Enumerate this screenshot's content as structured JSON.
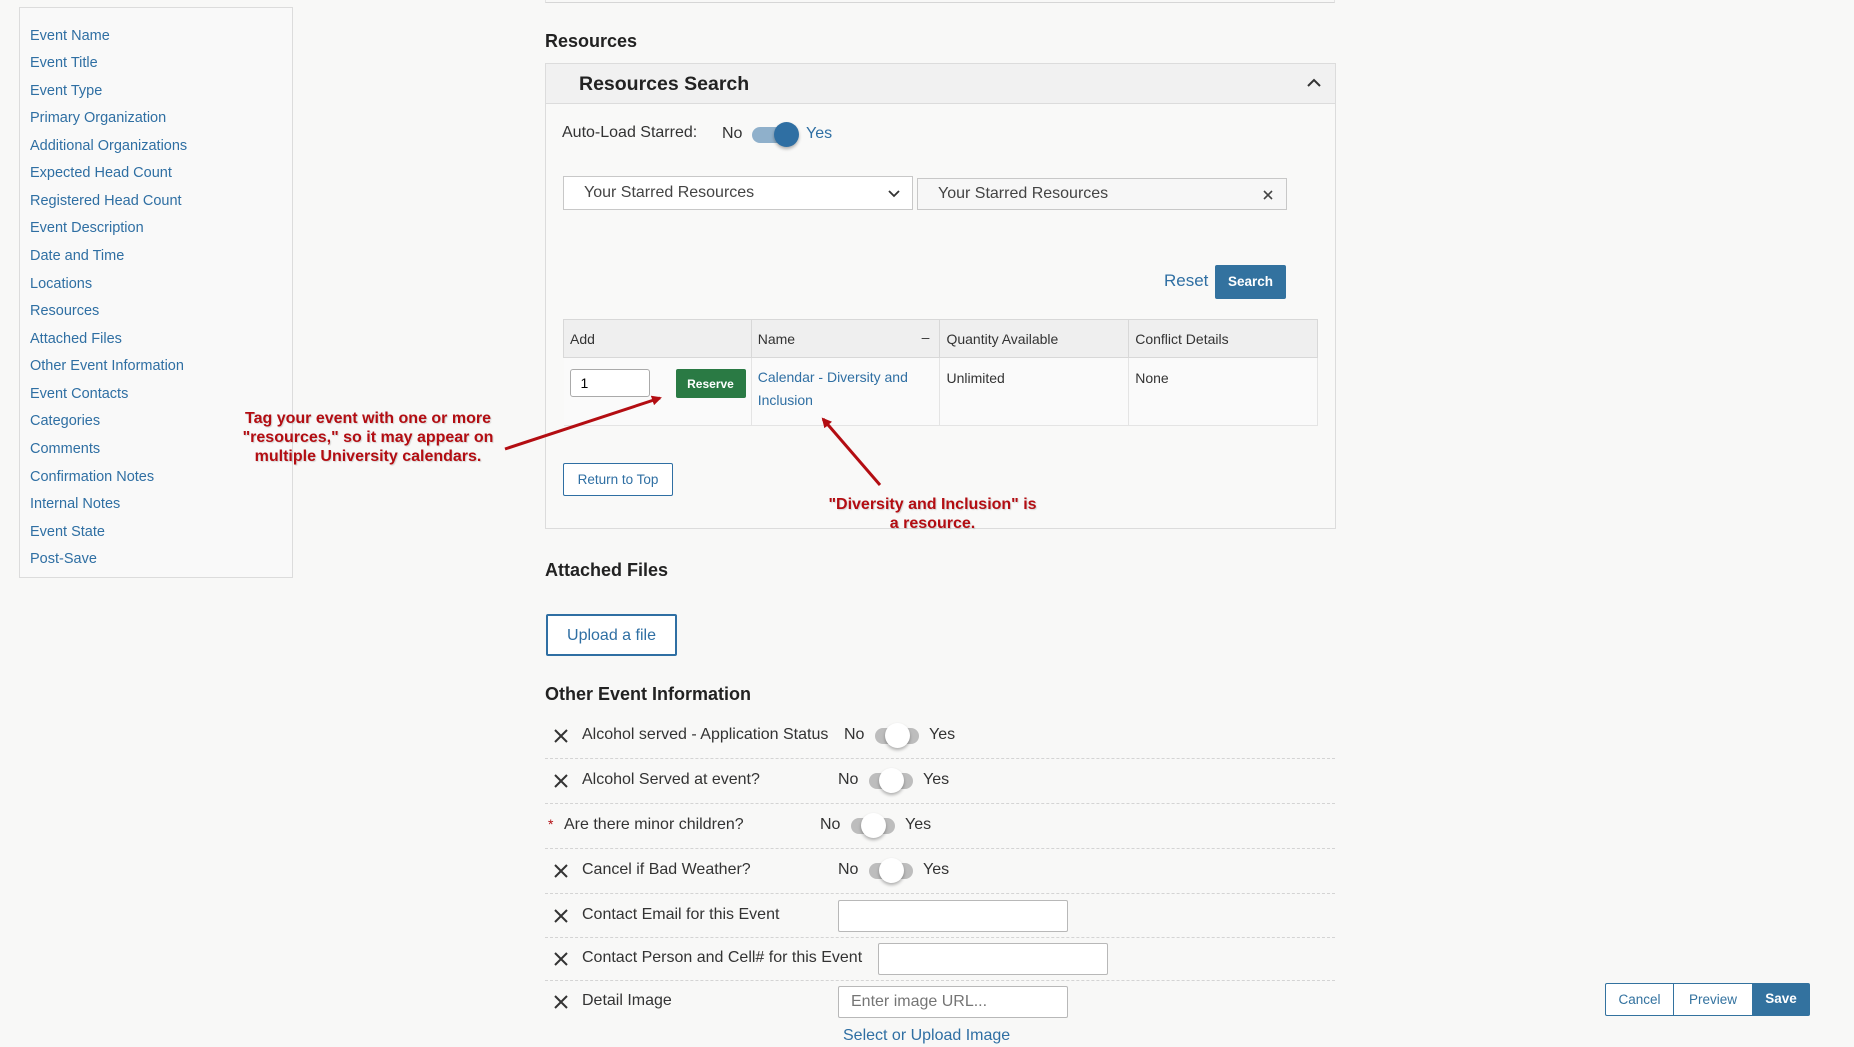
{
  "sidebar": {
    "items": [
      {
        "label": "Event Name"
      },
      {
        "label": "Event Title"
      },
      {
        "label": "Event Type"
      },
      {
        "label": "Primary Organization"
      },
      {
        "label": "Additional Organizations"
      },
      {
        "label": "Expected Head Count"
      },
      {
        "label": "Registered Head Count"
      },
      {
        "label": "Event Description"
      },
      {
        "label": "Date and Time"
      },
      {
        "label": "Locations"
      },
      {
        "label": "Resources"
      },
      {
        "label": "Attached Files"
      },
      {
        "label": "Other Event Information"
      },
      {
        "label": "Event Contacts"
      },
      {
        "label": "Categories"
      },
      {
        "label": "Comments"
      },
      {
        "label": "Confirmation Notes"
      },
      {
        "label": "Internal Notes"
      },
      {
        "label": "Event State"
      },
      {
        "label": "Post-Save"
      }
    ]
  },
  "resources": {
    "heading": "Resources",
    "panel_title": "Resources Search",
    "auto_load_label": "Auto-Load Starred:",
    "toggle_no": "No",
    "toggle_yes": "Yes",
    "auto_load_on": true,
    "dropdown_value": "Your Starred Resources",
    "filter_value": "Your Starred Resources",
    "reset_label": "Reset",
    "search_label": "Search",
    "table": {
      "headers": [
        "Add",
        "Name",
        "Quantity Available",
        "Conflict Details"
      ],
      "name_sort_icon": "–",
      "rows": [
        {
          "quantity_input": "1",
          "reserve_label": "Reserve",
          "name": "Calendar - Diversity and Inclusion",
          "quantity": "Unlimited",
          "conflict": "None"
        }
      ]
    },
    "return_top_label": "Return to Top"
  },
  "annotations": {
    "left": "Tag your event with one or more \"resources,\" so it may appear on multiple University calendars.",
    "right": "\"Diversity and Inclusion\" is a resource.",
    "color": "#b30d12"
  },
  "attached_files": {
    "heading": "Attached Files",
    "upload_label": "Upload a file"
  },
  "other_info": {
    "heading": "Other Event Information",
    "toggle_rows": [
      {
        "label": "Alcohol served - Application Status",
        "no": "No",
        "yes": "Yes",
        "on": false,
        "required": false
      },
      {
        "label": "Alcohol Served at event?",
        "no": "No",
        "yes": "Yes",
        "on": false,
        "required": false
      },
      {
        "label": "Are there minor children?",
        "no": "No",
        "yes": "Yes",
        "on": false,
        "required": true
      },
      {
        "label": "Cancel if Bad Weather?",
        "no": "No",
        "yes": "Yes",
        "on": false,
        "required": false
      }
    ],
    "required_marker": "*",
    "contact_email_label": "Contact Email for this Event",
    "contact_email_value": "",
    "contact_person_label": "Contact Person and Cell# for this Event",
    "contact_person_value": "",
    "detail_image_label": "Detail Image",
    "detail_image_placeholder": "Enter image URL...",
    "select_upload_label": "Select or Upload Image"
  },
  "footer": {
    "cancel": "Cancel",
    "preview": "Preview",
    "save": "Save"
  },
  "colors": {
    "accent": "#33729f",
    "link": "#2f6fa3",
    "reserve": "#2a7a44",
    "required": "#b30d12"
  }
}
